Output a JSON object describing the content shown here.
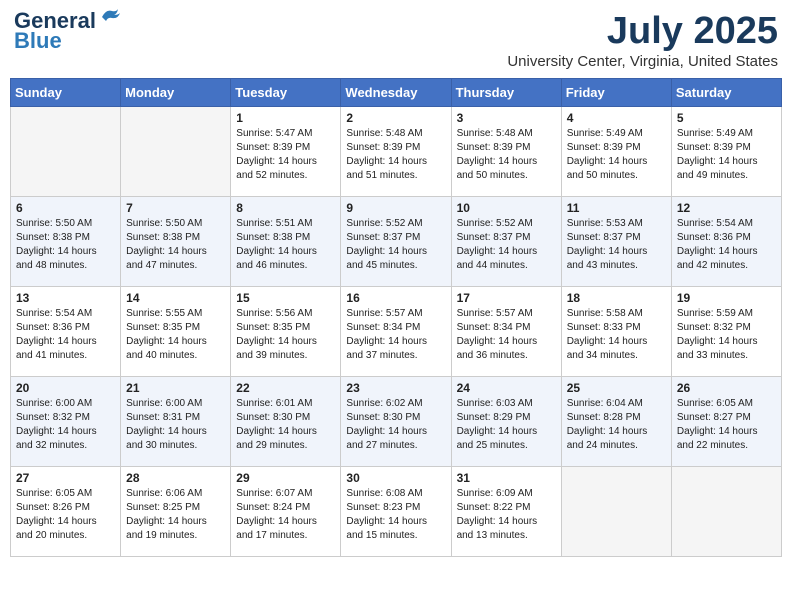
{
  "logo": {
    "general": "General",
    "blue": "Blue"
  },
  "title": "July 2025",
  "subtitle": "University Center, Virginia, United States",
  "days_of_week": [
    "Sunday",
    "Monday",
    "Tuesday",
    "Wednesday",
    "Thursday",
    "Friday",
    "Saturday"
  ],
  "weeks": [
    [
      {
        "day": "",
        "info": ""
      },
      {
        "day": "",
        "info": ""
      },
      {
        "day": "1",
        "info": "Sunrise: 5:47 AM\nSunset: 8:39 PM\nDaylight: 14 hours and 52 minutes."
      },
      {
        "day": "2",
        "info": "Sunrise: 5:48 AM\nSunset: 8:39 PM\nDaylight: 14 hours and 51 minutes."
      },
      {
        "day": "3",
        "info": "Sunrise: 5:48 AM\nSunset: 8:39 PM\nDaylight: 14 hours and 50 minutes."
      },
      {
        "day": "4",
        "info": "Sunrise: 5:49 AM\nSunset: 8:39 PM\nDaylight: 14 hours and 50 minutes."
      },
      {
        "day": "5",
        "info": "Sunrise: 5:49 AM\nSunset: 8:39 PM\nDaylight: 14 hours and 49 minutes."
      }
    ],
    [
      {
        "day": "6",
        "info": "Sunrise: 5:50 AM\nSunset: 8:38 PM\nDaylight: 14 hours and 48 minutes."
      },
      {
        "day": "7",
        "info": "Sunrise: 5:50 AM\nSunset: 8:38 PM\nDaylight: 14 hours and 47 minutes."
      },
      {
        "day": "8",
        "info": "Sunrise: 5:51 AM\nSunset: 8:38 PM\nDaylight: 14 hours and 46 minutes."
      },
      {
        "day": "9",
        "info": "Sunrise: 5:52 AM\nSunset: 8:37 PM\nDaylight: 14 hours and 45 minutes."
      },
      {
        "day": "10",
        "info": "Sunrise: 5:52 AM\nSunset: 8:37 PM\nDaylight: 14 hours and 44 minutes."
      },
      {
        "day": "11",
        "info": "Sunrise: 5:53 AM\nSunset: 8:37 PM\nDaylight: 14 hours and 43 minutes."
      },
      {
        "day": "12",
        "info": "Sunrise: 5:54 AM\nSunset: 8:36 PM\nDaylight: 14 hours and 42 minutes."
      }
    ],
    [
      {
        "day": "13",
        "info": "Sunrise: 5:54 AM\nSunset: 8:36 PM\nDaylight: 14 hours and 41 minutes."
      },
      {
        "day": "14",
        "info": "Sunrise: 5:55 AM\nSunset: 8:35 PM\nDaylight: 14 hours and 40 minutes."
      },
      {
        "day": "15",
        "info": "Sunrise: 5:56 AM\nSunset: 8:35 PM\nDaylight: 14 hours and 39 minutes."
      },
      {
        "day": "16",
        "info": "Sunrise: 5:57 AM\nSunset: 8:34 PM\nDaylight: 14 hours and 37 minutes."
      },
      {
        "day": "17",
        "info": "Sunrise: 5:57 AM\nSunset: 8:34 PM\nDaylight: 14 hours and 36 minutes."
      },
      {
        "day": "18",
        "info": "Sunrise: 5:58 AM\nSunset: 8:33 PM\nDaylight: 14 hours and 34 minutes."
      },
      {
        "day": "19",
        "info": "Sunrise: 5:59 AM\nSunset: 8:32 PM\nDaylight: 14 hours and 33 minutes."
      }
    ],
    [
      {
        "day": "20",
        "info": "Sunrise: 6:00 AM\nSunset: 8:32 PM\nDaylight: 14 hours and 32 minutes."
      },
      {
        "day": "21",
        "info": "Sunrise: 6:00 AM\nSunset: 8:31 PM\nDaylight: 14 hours and 30 minutes."
      },
      {
        "day": "22",
        "info": "Sunrise: 6:01 AM\nSunset: 8:30 PM\nDaylight: 14 hours and 29 minutes."
      },
      {
        "day": "23",
        "info": "Sunrise: 6:02 AM\nSunset: 8:30 PM\nDaylight: 14 hours and 27 minutes."
      },
      {
        "day": "24",
        "info": "Sunrise: 6:03 AM\nSunset: 8:29 PM\nDaylight: 14 hours and 25 minutes."
      },
      {
        "day": "25",
        "info": "Sunrise: 6:04 AM\nSunset: 8:28 PM\nDaylight: 14 hours and 24 minutes."
      },
      {
        "day": "26",
        "info": "Sunrise: 6:05 AM\nSunset: 8:27 PM\nDaylight: 14 hours and 22 minutes."
      }
    ],
    [
      {
        "day": "27",
        "info": "Sunrise: 6:05 AM\nSunset: 8:26 PM\nDaylight: 14 hours and 20 minutes."
      },
      {
        "day": "28",
        "info": "Sunrise: 6:06 AM\nSunset: 8:25 PM\nDaylight: 14 hours and 19 minutes."
      },
      {
        "day": "29",
        "info": "Sunrise: 6:07 AM\nSunset: 8:24 PM\nDaylight: 14 hours and 17 minutes."
      },
      {
        "day": "30",
        "info": "Sunrise: 6:08 AM\nSunset: 8:23 PM\nDaylight: 14 hours and 15 minutes."
      },
      {
        "day": "31",
        "info": "Sunrise: 6:09 AM\nSunset: 8:22 PM\nDaylight: 14 hours and 13 minutes."
      },
      {
        "day": "",
        "info": ""
      },
      {
        "day": "",
        "info": ""
      }
    ]
  ]
}
